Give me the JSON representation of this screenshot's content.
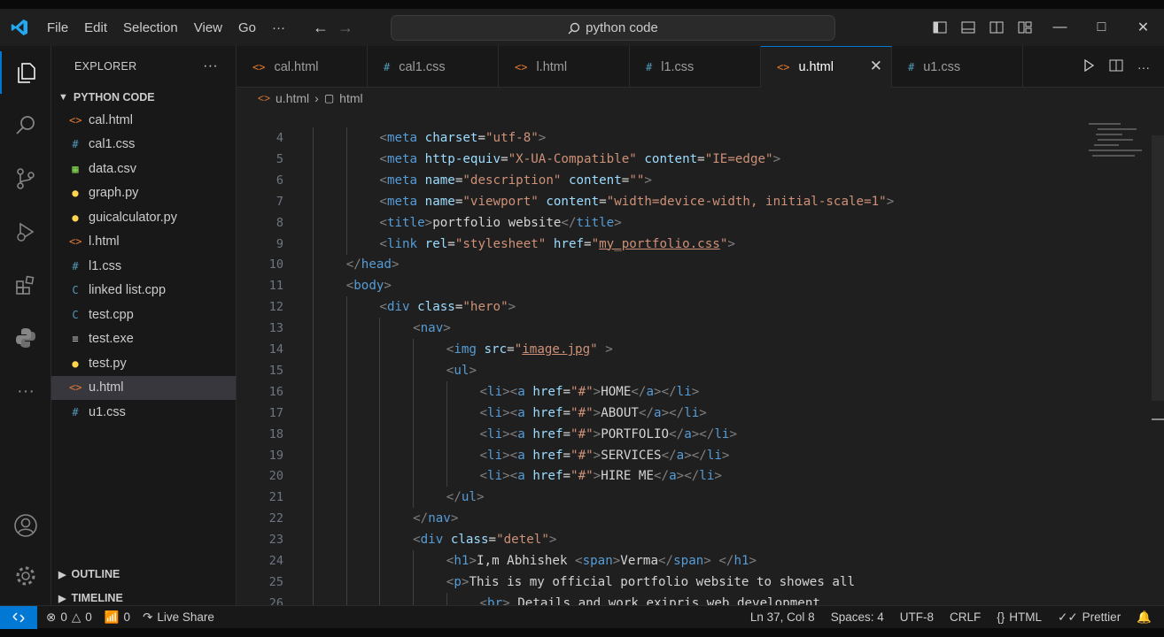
{
  "titlebar": {
    "menu": [
      "File",
      "Edit",
      "Selection",
      "View",
      "Go",
      "···"
    ],
    "search": "python code"
  },
  "explorer": {
    "title": "EXPLORER",
    "folder": "PYTHON CODE",
    "files": [
      {
        "name": "cal.html",
        "icon": "<>",
        "color": "#e37933"
      },
      {
        "name": "cal1.css",
        "icon": "#",
        "color": "#519aba"
      },
      {
        "name": "data.csv",
        "icon": "▦",
        "color": "#89e051"
      },
      {
        "name": "graph.py",
        "icon": "●",
        "color": "#ffd54f"
      },
      {
        "name": "guicalculator.py",
        "icon": "●",
        "color": "#ffd54f"
      },
      {
        "name": "l.html",
        "icon": "<>",
        "color": "#e37933"
      },
      {
        "name": "l1.css",
        "icon": "#",
        "color": "#519aba"
      },
      {
        "name": "linked list.cpp",
        "icon": "C",
        "color": "#519aba"
      },
      {
        "name": "test.cpp",
        "icon": "C",
        "color": "#519aba"
      },
      {
        "name": "test.exe",
        "icon": "≡",
        "color": "#cccccc"
      },
      {
        "name": "test.py",
        "icon": "●",
        "color": "#ffd54f"
      },
      {
        "name": "u.html",
        "icon": "<>",
        "color": "#e37933",
        "selected": true
      },
      {
        "name": "u1.css",
        "icon": "#",
        "color": "#519aba"
      }
    ],
    "outline": "OUTLINE",
    "timeline": "TIMELINE"
  },
  "tabs": [
    {
      "name": "cal.html",
      "icon": "<>",
      "color": "#e37933"
    },
    {
      "name": "cal1.css",
      "icon": "#",
      "color": "#519aba"
    },
    {
      "name": "l.html",
      "icon": "<>",
      "color": "#e37933"
    },
    {
      "name": "l1.css",
      "icon": "#",
      "color": "#519aba"
    },
    {
      "name": "u.html",
      "icon": "<>",
      "color": "#e37933",
      "active": true
    },
    {
      "name": "u1.css",
      "icon": "#",
      "color": "#519aba"
    }
  ],
  "breadcrumb": {
    "file": "u.html",
    "node": "html"
  },
  "editor": {
    "lines": [
      {
        "n": 4,
        "indent": 2,
        "tokens": [
          [
            "tg",
            "<"
          ],
          [
            "tn",
            "meta "
          ],
          [
            "at",
            "charset"
          ],
          [
            "tx",
            "="
          ],
          [
            "st",
            "\"utf-8\""
          ],
          [
            "tg",
            ">"
          ]
        ]
      },
      {
        "n": 5,
        "indent": 2,
        "tokens": [
          [
            "tg",
            "<"
          ],
          [
            "tn",
            "meta "
          ],
          [
            "at",
            "http-equiv"
          ],
          [
            "tx",
            "="
          ],
          [
            "st",
            "\"X-UA-Compatible\" "
          ],
          [
            "at",
            "content"
          ],
          [
            "tx",
            "="
          ],
          [
            "st",
            "\"IE=edge\""
          ],
          [
            "tg",
            ">"
          ]
        ]
      },
      {
        "n": 6,
        "indent": 2,
        "tokens": [
          [
            "tg",
            "<"
          ],
          [
            "tn",
            "meta "
          ],
          [
            "at",
            "name"
          ],
          [
            "tx",
            "="
          ],
          [
            "st",
            "\"description\" "
          ],
          [
            "at",
            "content"
          ],
          [
            "tx",
            "="
          ],
          [
            "st",
            "\"\""
          ],
          [
            "tg",
            ">"
          ]
        ]
      },
      {
        "n": 7,
        "indent": 2,
        "tokens": [
          [
            "tg",
            "<"
          ],
          [
            "tn",
            "meta "
          ],
          [
            "at",
            "name"
          ],
          [
            "tx",
            "="
          ],
          [
            "st",
            "\"viewport\" "
          ],
          [
            "at",
            "content"
          ],
          [
            "tx",
            "="
          ],
          [
            "st",
            "\"width=device-width, initial-scale=1\""
          ],
          [
            "tg",
            ">"
          ]
        ]
      },
      {
        "n": 8,
        "indent": 2,
        "tokens": [
          [
            "tg",
            "<"
          ],
          [
            "tn",
            "title"
          ],
          [
            "tg",
            ">"
          ],
          [
            "tx",
            "portfolio website"
          ],
          [
            "tg",
            "</"
          ],
          [
            "tn",
            "title"
          ],
          [
            "tg",
            ">"
          ]
        ]
      },
      {
        "n": 9,
        "indent": 2,
        "tokens": [
          [
            "tg",
            "<"
          ],
          [
            "tn",
            "link "
          ],
          [
            "at",
            "rel"
          ],
          [
            "tx",
            "="
          ],
          [
            "st",
            "\"stylesheet\" "
          ],
          [
            "at",
            "href"
          ],
          [
            "tx",
            "="
          ],
          [
            "st",
            "\""
          ],
          [
            "stu",
            "my_portfolio.css"
          ],
          [
            "st",
            "\""
          ],
          [
            "tg",
            ">"
          ]
        ]
      },
      {
        "n": 10,
        "indent": 1,
        "tokens": [
          [
            "tg",
            "</"
          ],
          [
            "tn",
            "head"
          ],
          [
            "tg",
            ">"
          ]
        ]
      },
      {
        "n": 11,
        "indent": 1,
        "tokens": [
          [
            "tg",
            "<"
          ],
          [
            "tn",
            "body"
          ],
          [
            "tg",
            ">"
          ]
        ]
      },
      {
        "n": 12,
        "indent": 2,
        "tokens": [
          [
            "tg",
            "<"
          ],
          [
            "tn",
            "div "
          ],
          [
            "at",
            "class"
          ],
          [
            "tx",
            "="
          ],
          [
            "st",
            "\"hero\""
          ],
          [
            "tg",
            ">"
          ]
        ]
      },
      {
        "n": 13,
        "indent": 3,
        "tokens": [
          [
            "tg",
            "<"
          ],
          [
            "tn",
            "nav"
          ],
          [
            "tg",
            ">"
          ]
        ]
      },
      {
        "n": 14,
        "indent": 4,
        "tokens": [
          [
            "tg",
            "<"
          ],
          [
            "tn",
            "img "
          ],
          [
            "at",
            "src"
          ],
          [
            "tx",
            "="
          ],
          [
            "st",
            "\""
          ],
          [
            "stu",
            "image.jpg"
          ],
          [
            "st",
            "\" "
          ],
          [
            "tg",
            ">"
          ]
        ]
      },
      {
        "n": 15,
        "indent": 4,
        "tokens": [
          [
            "tg",
            "<"
          ],
          [
            "tn",
            "ul"
          ],
          [
            "tg",
            ">"
          ]
        ]
      },
      {
        "n": 16,
        "indent": 5,
        "tokens": [
          [
            "tg",
            "<"
          ],
          [
            "tn",
            "li"
          ],
          [
            "tg",
            "><"
          ],
          [
            "tn",
            "a "
          ],
          [
            "at",
            "href"
          ],
          [
            "tx",
            "="
          ],
          [
            "st",
            "\"#\""
          ],
          [
            "tg",
            ">"
          ],
          [
            "tx",
            "HOME"
          ],
          [
            "tg",
            "</"
          ],
          [
            "tn",
            "a"
          ],
          [
            "tg",
            "></"
          ],
          [
            "tn",
            "li"
          ],
          [
            "tg",
            ">"
          ]
        ]
      },
      {
        "n": 17,
        "indent": 5,
        "tokens": [
          [
            "tg",
            "<"
          ],
          [
            "tn",
            "li"
          ],
          [
            "tg",
            "><"
          ],
          [
            "tn",
            "a "
          ],
          [
            "at",
            "href"
          ],
          [
            "tx",
            "="
          ],
          [
            "st",
            "\"#\""
          ],
          [
            "tg",
            ">"
          ],
          [
            "tx",
            "ABOUT"
          ],
          [
            "tg",
            "</"
          ],
          [
            "tn",
            "a"
          ],
          [
            "tg",
            "></"
          ],
          [
            "tn",
            "li"
          ],
          [
            "tg",
            ">"
          ]
        ]
      },
      {
        "n": 18,
        "indent": 5,
        "tokens": [
          [
            "tg",
            "<"
          ],
          [
            "tn",
            "li"
          ],
          [
            "tg",
            "><"
          ],
          [
            "tn",
            "a "
          ],
          [
            "at",
            "href"
          ],
          [
            "tx",
            "="
          ],
          [
            "st",
            "\"#\""
          ],
          [
            "tg",
            ">"
          ],
          [
            "tx",
            "PORTFOLIO"
          ],
          [
            "tg",
            "</"
          ],
          [
            "tn",
            "a"
          ],
          [
            "tg",
            "></"
          ],
          [
            "tn",
            "li"
          ],
          [
            "tg",
            ">"
          ]
        ]
      },
      {
        "n": 19,
        "indent": 5,
        "tokens": [
          [
            "tg",
            "<"
          ],
          [
            "tn",
            "li"
          ],
          [
            "tg",
            "><"
          ],
          [
            "tn",
            "a "
          ],
          [
            "at",
            "href"
          ],
          [
            "tx",
            "="
          ],
          [
            "st",
            "\"#\""
          ],
          [
            "tg",
            ">"
          ],
          [
            "tx",
            "SERVICES"
          ],
          [
            "tg",
            "</"
          ],
          [
            "tn",
            "a"
          ],
          [
            "tg",
            "></"
          ],
          [
            "tn",
            "li"
          ],
          [
            "tg",
            ">"
          ]
        ]
      },
      {
        "n": 20,
        "indent": 5,
        "tokens": [
          [
            "tg",
            "<"
          ],
          [
            "tn",
            "li"
          ],
          [
            "tg",
            "><"
          ],
          [
            "tn",
            "a "
          ],
          [
            "at",
            "href"
          ],
          [
            "tx",
            "="
          ],
          [
            "st",
            "\"#\""
          ],
          [
            "tg",
            ">"
          ],
          [
            "tx",
            "HIRE ME"
          ],
          [
            "tg",
            "</"
          ],
          [
            "tn",
            "a"
          ],
          [
            "tg",
            "></"
          ],
          [
            "tn",
            "li"
          ],
          [
            "tg",
            ">"
          ]
        ]
      },
      {
        "n": 21,
        "indent": 4,
        "tokens": [
          [
            "tg",
            "</"
          ],
          [
            "tn",
            "ul"
          ],
          [
            "tg",
            ">"
          ]
        ]
      },
      {
        "n": 22,
        "indent": 3,
        "tokens": [
          [
            "tg",
            "</"
          ],
          [
            "tn",
            "nav"
          ],
          [
            "tg",
            ">"
          ]
        ]
      },
      {
        "n": 23,
        "indent": 3,
        "tokens": [
          [
            "tg",
            "<"
          ],
          [
            "tn",
            "div "
          ],
          [
            "at",
            "class"
          ],
          [
            "tx",
            "="
          ],
          [
            "st",
            "\"detel\""
          ],
          [
            "tg",
            ">"
          ]
        ]
      },
      {
        "n": 24,
        "indent": 4,
        "tokens": [
          [
            "tg",
            "<"
          ],
          [
            "tn",
            "h1"
          ],
          [
            "tg",
            ">"
          ],
          [
            "tx",
            "I,m Abhishek "
          ],
          [
            "tg",
            "<"
          ],
          [
            "tn",
            "span"
          ],
          [
            "tg",
            ">"
          ],
          [
            "tx",
            "Verma"
          ],
          [
            "tg",
            "</"
          ],
          [
            "tn",
            "span"
          ],
          [
            "tg",
            "> </"
          ],
          [
            "tn",
            "h1"
          ],
          [
            "tg",
            ">"
          ]
        ]
      },
      {
        "n": 25,
        "indent": 4,
        "tokens": [
          [
            "tg",
            "<"
          ],
          [
            "tn",
            "p"
          ],
          [
            "tg",
            ">"
          ],
          [
            "tx",
            "This is my official portfolio website to showes all"
          ]
        ]
      },
      {
        "n": 26,
        "indent": 5,
        "tokens": [
          [
            "tg",
            "<"
          ],
          [
            "tn",
            "br"
          ],
          [
            "tg",
            "> "
          ],
          [
            "tx",
            "Details and work exipris web development"
          ]
        ]
      }
    ]
  },
  "statusbar": {
    "errors": "0",
    "warnings": "0",
    "ports": "0",
    "liveshare": "Live Share",
    "position": "Ln 37, Col 8",
    "spaces": "Spaces: 4",
    "encoding": "UTF-8",
    "eol": "CRLF",
    "language": "HTML",
    "prettier": "Prettier"
  }
}
